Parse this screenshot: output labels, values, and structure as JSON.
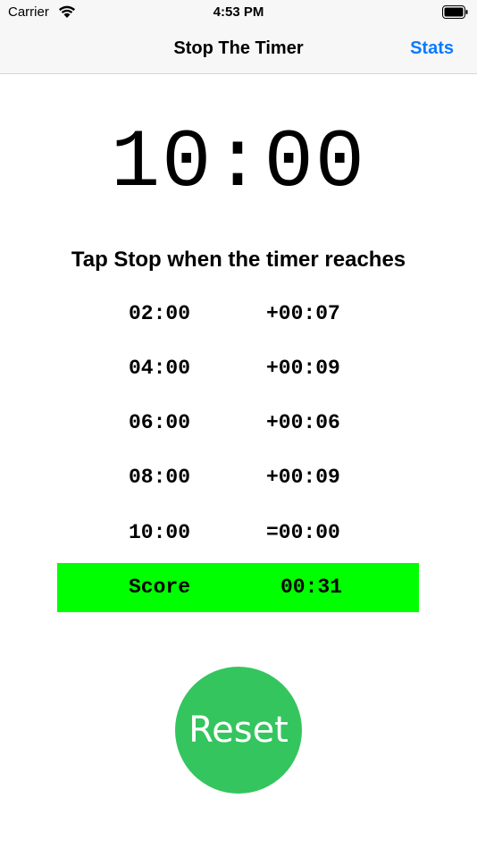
{
  "status_bar": {
    "carrier": "Carrier",
    "time": "4:53 PM",
    "wifi_icon": "wifi-icon",
    "battery_icon": "battery-icon"
  },
  "nav": {
    "title": "Stop The Timer",
    "stats_label": "Stats",
    "accent_color": "#0a7aff"
  },
  "timer": {
    "display": "10:00"
  },
  "instruction": "Tap Stop when the timer reaches",
  "results": [
    {
      "target": "02:00",
      "delta": "+00:07"
    },
    {
      "target": "04:00",
      "delta": "+00:09"
    },
    {
      "target": "06:00",
      "delta": "+00:06"
    },
    {
      "target": "08:00",
      "delta": "+00:09"
    },
    {
      "target": "10:00",
      "delta": "=00:00"
    }
  ],
  "score": {
    "label": "Score",
    "value": "00:31",
    "highlight_color": "#00ff00"
  },
  "reset": {
    "label": "Reset",
    "color": "#34c55e"
  }
}
